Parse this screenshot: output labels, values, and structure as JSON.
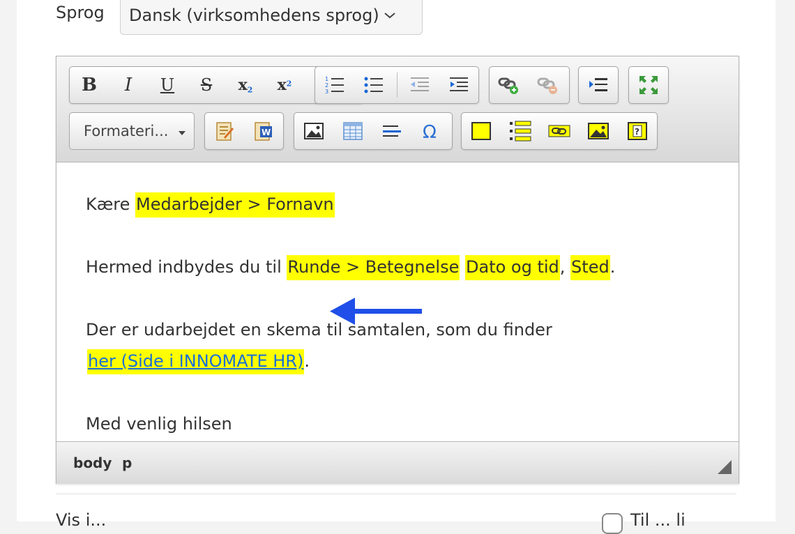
{
  "language": {
    "label": "Sprog",
    "selected": "Dansk (virksomhedens sprog)"
  },
  "toolbar": {
    "bold": "B",
    "italic": "I",
    "underline": "U",
    "strike": "S",
    "subscript": "x",
    "subscript_index": "2",
    "superscript": "x",
    "superscript_index": "2",
    "format_label": "Formateri...",
    "icons": [
      "numbered-list-icon",
      "bulleted-list-icon",
      "outdent-icon",
      "indent-icon",
      "link-icon",
      "unlink-icon",
      "blockquote-icon",
      "maximize-icon",
      "paste-text-icon",
      "paste-word-icon",
      "image-icon",
      "table-icon",
      "horizontal-rule-icon",
      "special-char-icon",
      "merge-field-icon",
      "merge-list-icon",
      "merge-link-icon",
      "merge-image-icon",
      "merge-question-icon"
    ]
  },
  "content": {
    "line1_text": "Kære ",
    "line1_field": "Medarbejder > Fornavn",
    "line2_text": "Hermed indbydes du til ",
    "line2_field1": "Runde > Betegnelse",
    "line2_field2": "Dato og tid",
    "line2_comma": ", ",
    "line2_field3": "Sted",
    "line2_period": ".",
    "line3_text": "Der er udarbejdet en skema til samtalen, som du finder",
    "line4_link": "her (Side i INNOMATE HR)",
    "line4_period": ".",
    "line5_text": "Med venlig hilsen"
  },
  "statusbar": {
    "path": [
      "body",
      "p"
    ]
  },
  "bottom": {
    "left_label": "Vis i...",
    "right_label": "Til ... li"
  },
  "colors": {
    "merge_highlight": "#ffff00",
    "link": "#1a6fd8",
    "arrow": "#1f4fe8"
  }
}
